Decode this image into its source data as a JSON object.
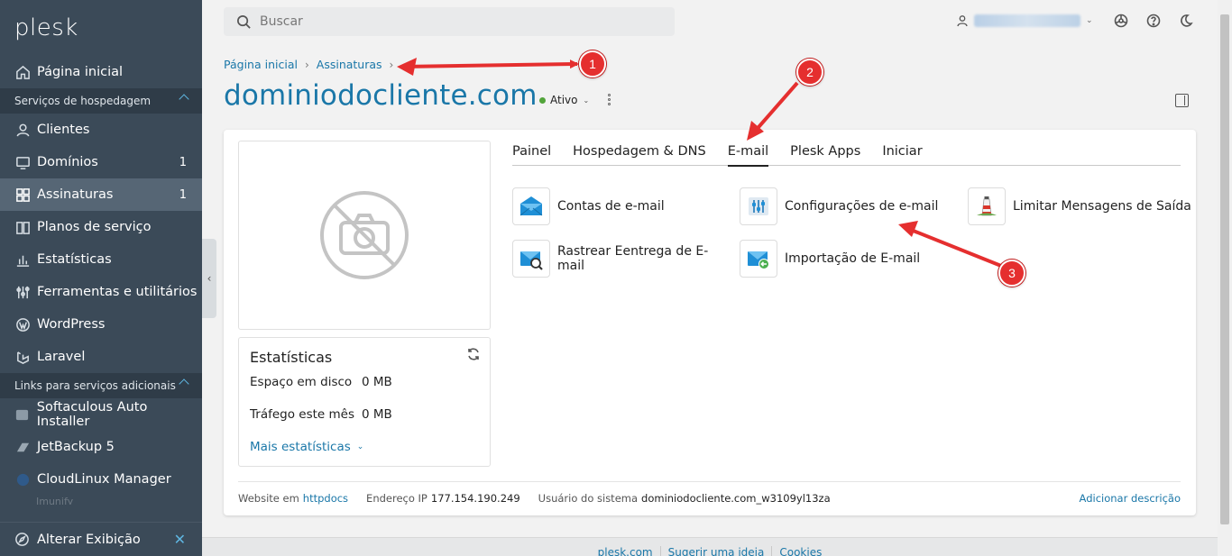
{
  "sidebar": {
    "logo": "plesk",
    "home": "Página inicial",
    "section_hosting": "Serviços de hospedagem",
    "items": [
      {
        "label": "Clientes",
        "icon": "user-icon",
        "count": ""
      },
      {
        "label": "Domínios",
        "icon": "monitor-icon",
        "count": "1"
      },
      {
        "label": "Assinaturas",
        "icon": "grid-icon",
        "count": "1"
      },
      {
        "label": "Planos de serviço",
        "icon": "book-icon",
        "count": ""
      },
      {
        "label": "Estatísticas",
        "icon": "chart-icon",
        "count": ""
      },
      {
        "label": "Ferramentas e utilitários",
        "icon": "sliders-icon",
        "count": ""
      },
      {
        "label": "WordPress",
        "icon": "wordpress-icon",
        "count": ""
      },
      {
        "label": "Laravel",
        "icon": "laravel-icon",
        "count": ""
      }
    ],
    "section_links": "Links para serviços adicionais",
    "links": [
      {
        "label": "Softaculous Auto Installer",
        "icon": "softaculous-icon"
      },
      {
        "label": "JetBackup 5",
        "icon": "jetbackup-icon"
      },
      {
        "label": "CloudLinux Manager",
        "icon": "cloudlinux-icon"
      }
    ],
    "faded_item": "Imunify",
    "bottom_label": "Alterar Exibição"
  },
  "search": {
    "placeholder": "Buscar"
  },
  "breadcrumb": {
    "home": "Página inicial",
    "current": "Assinaturas"
  },
  "page": {
    "title": "dominiodocliente.com",
    "status": "Ativo",
    "status_color": "#52a43a"
  },
  "stats": {
    "title": "Estatísticas",
    "rows": [
      {
        "label": "Espaço em disco",
        "value": "0 MB"
      },
      {
        "label": "Tráfego este mês",
        "value": "0 MB"
      }
    ],
    "more": "Mais estatísticas"
  },
  "tabs": [
    "Painel",
    "Hospedagem & DNS",
    "E-mail",
    "Plesk Apps",
    "Iniciar"
  ],
  "active_tab": "E-mail",
  "actions": [
    {
      "label": "Contas de e-mail",
      "icon": "mail-accounts-icon"
    },
    {
      "label": "Configurações de e-mail",
      "icon": "mail-settings-icon"
    },
    {
      "label": "Limitar Mensagens de Saída",
      "icon": "lighthouse-icon"
    },
    {
      "label": "Rastrear Eentrega de E-mail",
      "icon": "mail-track-icon"
    },
    {
      "label": "Importação de E-mail",
      "icon": "mail-import-icon"
    }
  ],
  "footer_info": {
    "website_label": "Website em",
    "website_value": "httpdocs",
    "ip_label": "Endereço IP",
    "ip_value": "177.154.190.249",
    "user_label": "Usuário do sistema",
    "user_value": "dominiodocliente.com_w3109yl13za",
    "add_description": "Adicionar descrição"
  },
  "page_footer": [
    "plesk.com",
    "Sugerir uma ideia",
    "Cookies"
  ],
  "annotations": [
    "1",
    "2",
    "3"
  ],
  "colors": {
    "sidebar": "#3b4a58",
    "link": "#1a77a8",
    "annotation": "#e52f2f"
  }
}
